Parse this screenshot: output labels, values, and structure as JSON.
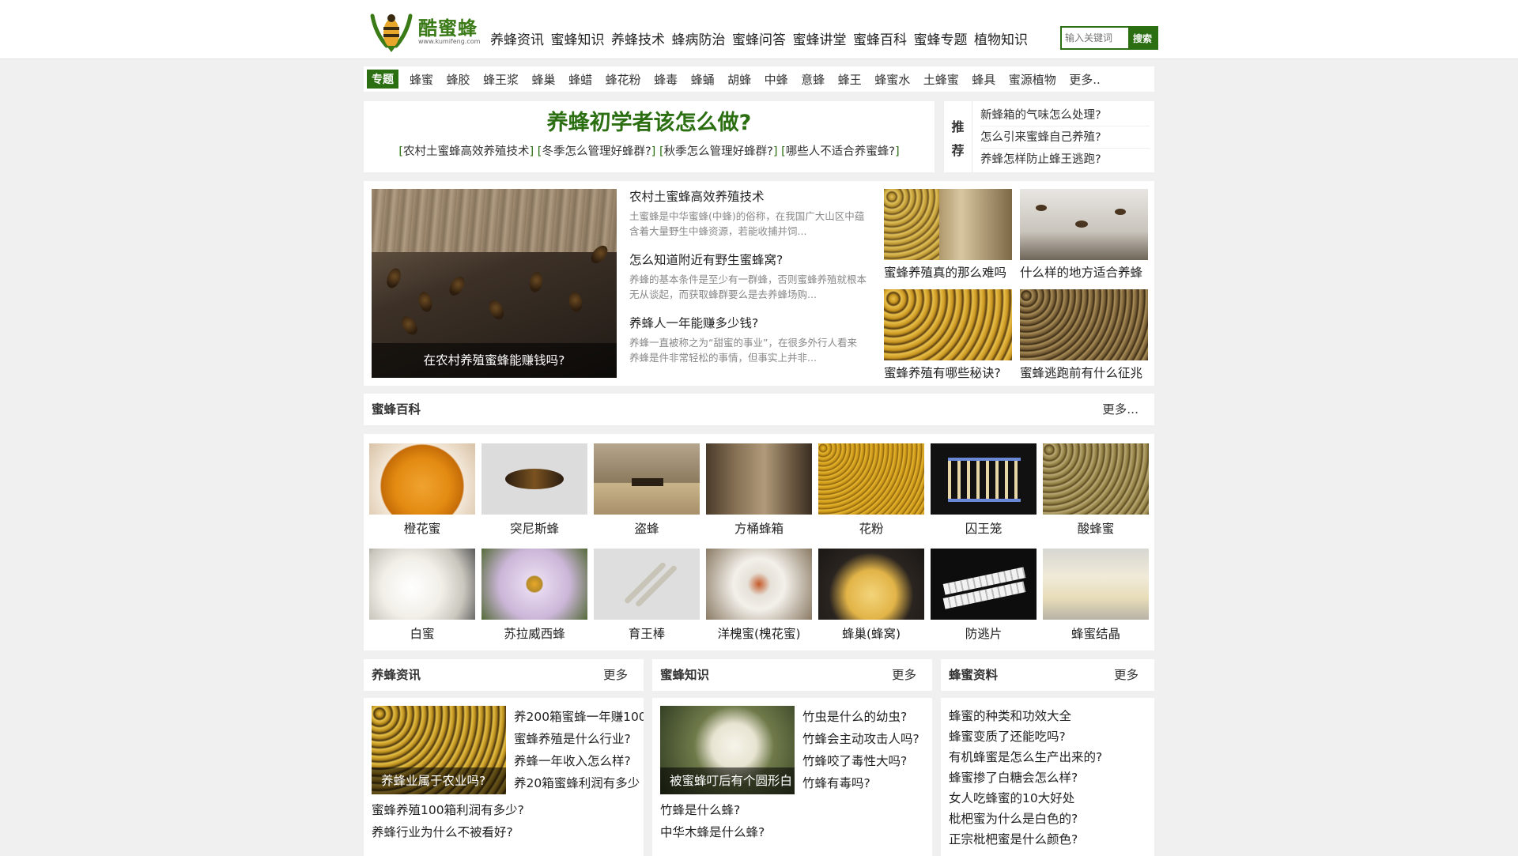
{
  "site": {
    "logo_text": "酷蜜蜂",
    "logo_sub": "www.kumifeng.com",
    "nav": [
      "养蜂资讯",
      "蜜蜂知识",
      "养蜂技术",
      "蜂病防治",
      "蜜蜂问答",
      "蜜蜂讲堂",
      "蜜蜂百科",
      "蜜蜂专题",
      "植物知识"
    ],
    "search": {
      "placeholder": "输入关键词",
      "button": "搜索"
    },
    "accent_color": "#2b6f12"
  },
  "topics": {
    "label": "专题",
    "items": [
      "蜂蜜",
      "蜂胶",
      "蜂王浆",
      "蜂巢",
      "蜂蜡",
      "蜂花粉",
      "蜂毒",
      "蜂蛹",
      "胡蜂",
      "中蜂",
      "意蜂",
      "蜂王",
      "蜂蜜水",
      "土蜂蜜",
      "蜂具",
      "蜜源植物",
      "更多.."
    ]
  },
  "headline": {
    "title": "养蜂初学者该怎么做?",
    "links": [
      "农村土蜜蜂高效养殖技术",
      "冬季怎么管理好蜂群?",
      "秋季怎么管理好蜂群?",
      "哪些人不适合养蜜蜂?"
    ]
  },
  "recommend": {
    "label": "推荐",
    "items": [
      "新蜂箱的气味怎么处理?",
      "怎么引来蜜蜂自己养殖?",
      "养蜂怎样防止蜂王逃跑?"
    ]
  },
  "feature": {
    "main_caption": "在农村养殖蜜蜂能赚钱吗?",
    "articles": [
      {
        "title": "农村土蜜蜂高效养殖技术",
        "desc": "土蜜蜂是中华蜜蜂(中蜂)的俗称，在我国广大山区中蕴含着大量野生中蜂资源，若能收捕并饲..."
      },
      {
        "title": "怎么知道附近有野生蜜蜂窝?",
        "desc": "养蜂的基本条件是至少有一群蜂，否则蜜蜂养殖就根本无从谈起，而获取蜂群要么是去养蜂场购..."
      },
      {
        "title": "养蜂人一年能赚多少钱?",
        "desc": "养蜂一直被称之为“甜蜜的事业”，在很多外行人看来养蜂是件非常轻松的事情，但事实上并非..."
      }
    ],
    "thumbs": [
      "蜜蜂养殖真的那么难吗",
      "什么样的地方适合养蜂",
      "蜜蜂养殖有哪些秘诀?",
      "蜜蜂逃跑前有什么征兆"
    ]
  },
  "encyclopedia": {
    "title": "蜜蜂百科",
    "more": "更多...",
    "items": [
      "橙花蜜",
      "突尼斯蜂",
      "盗蜂",
      "方桶蜂箱",
      "花粉",
      "囚王笼",
      "酸蜂蜜",
      "白蜜",
      "苏拉威西蜂",
      "育王棒",
      "洋槐蜜(槐花蜜)",
      "蜂巢(蜂窝)",
      "防逃片",
      "蜂蜜结晶"
    ]
  },
  "columns": [
    {
      "title": "养蜂资讯",
      "more": "更多",
      "pic_caption": "养蜂业属于农业吗?",
      "side": [
        "养200箱蜜蜂一年赚100",
        "蜜蜂养殖是什么行业?",
        "养蜂一年收入怎么样?",
        "养20箱蜜蜂利润有多少"
      ],
      "lower": [
        "蜜蜂养殖100箱利润有多少?",
        "养蜂行业为什么不被看好?"
      ]
    },
    {
      "title": "蜜蜂知识",
      "more": "更多",
      "pic_caption": "被蜜蜂叮后有个圆形白",
      "side": [
        "竹虫是什么的幼虫?",
        "竹蜂会主动攻击人吗?",
        "竹蜂咬了毒性大吗?",
        "竹蜂有毒吗?"
      ],
      "lower": [
        "竹蜂是什么蜂?",
        "中华木蜂是什么蜂?"
      ]
    },
    {
      "title": "蜂蜜资料",
      "more": "更多",
      "list": [
        "蜂蜜的种类和功效大全",
        "蜂蜜变质了还能吃吗?",
        "有机蜂蜜是怎么生产出来的?",
        "蜂蜜掺了白糖会怎么样?",
        "女人吃蜂蜜的10大好处",
        "枇杷蜜为什么是白色的?",
        "正宗枇杷蜜是什么颜色?"
      ]
    }
  ]
}
